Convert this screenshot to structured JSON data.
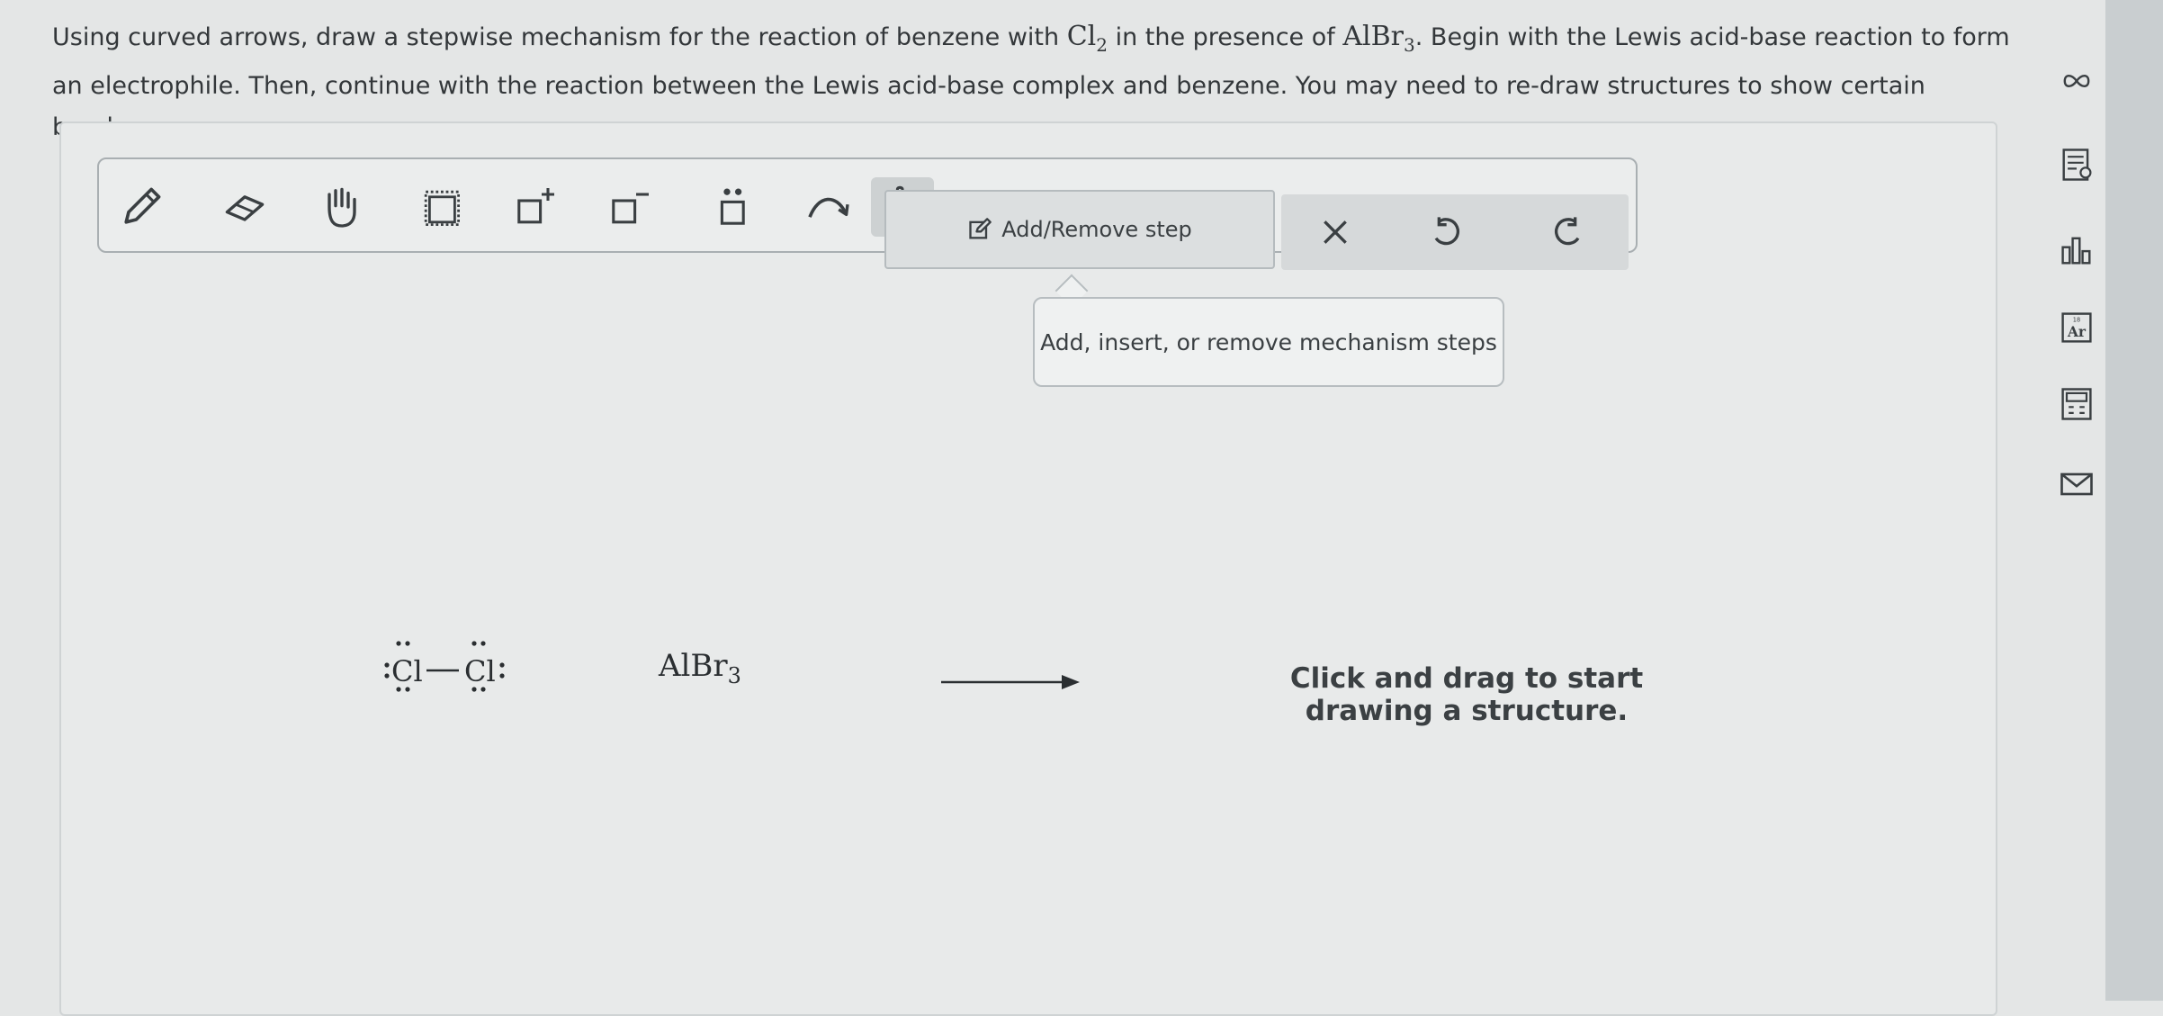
{
  "question": {
    "part1": "Using curved arrows, draw a stepwise mechanism for the reaction of benzene with ",
    "cl_main": "Cl",
    "cl_sub": "2",
    "part2": " in the presence of ",
    "alb_main": "AlBr",
    "alb_sub": "3",
    "part3": ". Begin with the Lewis acid-base reaction to form an electrophile. Then, continue with the reaction between the Lewis acid-base complex and benzene. You may need to re-draw structures to show certain bonds."
  },
  "toolbar": {
    "tools": [
      "pencil-icon",
      "eraser-icon",
      "hand-icon",
      "select-box-icon",
      "positive-charge-icon",
      "negative-charge-icon",
      "lone-pair-icon",
      "curved-arrow-icon",
      "pointer-hand-icon"
    ],
    "add_remove_label": "Add/Remove step",
    "close_symbol": "✕"
  },
  "tooltip": {
    "text": "Add, insert, or remove mechanism steps"
  },
  "sidebar": {
    "icons": [
      "infinity-icon",
      "notes-icon",
      "chart-icon",
      "periodic-table-icon",
      "calculator-icon",
      "mail-icon"
    ]
  },
  "canvas": {
    "cl2": {
      "atom_left": "Cl",
      "atom_right": "Cl"
    },
    "albr3_main": "AlBr",
    "albr3_sub": "3",
    "prompt_line1": "Click and drag to start",
    "prompt_line2": "drawing a structure."
  },
  "colors": {
    "background": "#e4e6e6",
    "toolbar_border": "#a9afb2",
    "text": "#2f3336"
  }
}
